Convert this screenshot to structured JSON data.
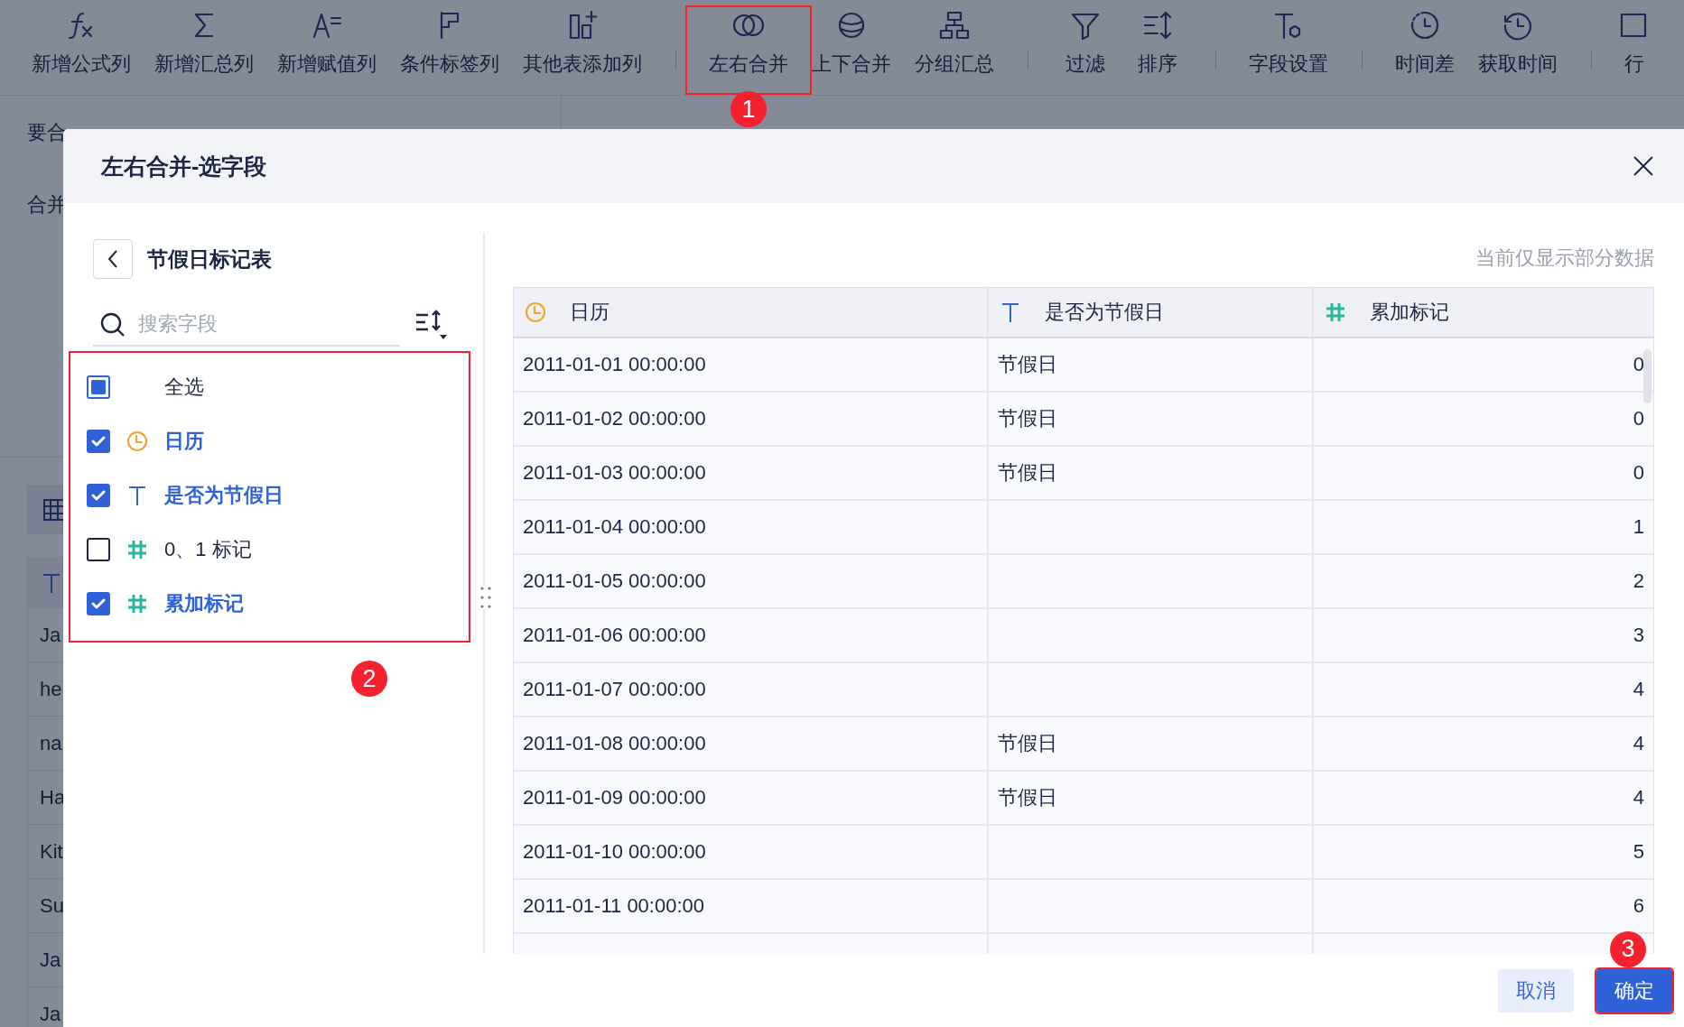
{
  "toolbar": {
    "items": [
      {
        "kind": "formula",
        "label": "新增公式列",
        "separator_before": false,
        "highlighted": false
      },
      {
        "kind": "sum",
        "label": "新增汇总列",
        "separator_before": false,
        "highlighted": false
      },
      {
        "kind": "assign",
        "label": "新增赋值列",
        "separator_before": false,
        "highlighted": false
      },
      {
        "kind": "tag",
        "label": "条件标签列",
        "separator_before": false,
        "highlighted": false
      },
      {
        "kind": "add-column",
        "label": "其他表添加列",
        "separator_before": false,
        "highlighted": false
      },
      {
        "kind": "join-lr",
        "label": "左右合并",
        "separator_before": true,
        "highlighted": true,
        "callout": "1"
      },
      {
        "kind": "join-tb",
        "label": "上下合并",
        "separator_before": false,
        "highlighted": false
      },
      {
        "kind": "group",
        "label": "分组汇总",
        "separator_before": false,
        "highlighted": false
      },
      {
        "kind": "filter",
        "label": "过滤",
        "separator_before": true,
        "highlighted": false
      },
      {
        "kind": "sort",
        "label": "排序",
        "separator_before": false,
        "highlighted": false
      },
      {
        "kind": "field-settings",
        "label": "字段设置",
        "separator_before": true,
        "highlighted": false
      },
      {
        "kind": "time-diff",
        "label": "时间差",
        "separator_before": true,
        "highlighted": false
      },
      {
        "kind": "get-time",
        "label": "获取时间",
        "separator_before": false,
        "highlighted": false
      },
      {
        "kind": "row",
        "label": "行",
        "separator_before": true,
        "highlighted": false
      }
    ]
  },
  "background": {
    "labels": [
      "要合",
      "合并"
    ],
    "table_rows": [
      "Ja",
      "he",
      "na",
      "Ha",
      "Kit",
      "Su",
      "Ja",
      "Ja"
    ]
  },
  "dialog": {
    "title": "左右合并-选字段",
    "source_table": "节假日标记表",
    "search": {
      "placeholder": "搜索字段"
    },
    "fields_callout": "2",
    "fields": [
      {
        "kind": "select-all",
        "label": "全选",
        "checked": false,
        "indeterminate": true
      },
      {
        "kind": "time",
        "label": "日历",
        "checked": true
      },
      {
        "kind": "text",
        "label": "是否为节假日",
        "checked": true
      },
      {
        "kind": "number",
        "label": "0、1 标记",
        "checked": false
      },
      {
        "kind": "number",
        "label": "累加标记",
        "checked": true
      }
    ],
    "preview_hint": "当前仅显示部分数据",
    "table": {
      "columns": [
        {
          "kind": "time",
          "label": "日历"
        },
        {
          "kind": "text",
          "label": "是否为节假日"
        },
        {
          "kind": "number",
          "label": "累加标记"
        }
      ],
      "rows": [
        [
          "2011-01-01 00:00:00",
          "节假日",
          "0"
        ],
        [
          "2011-01-02 00:00:00",
          "节假日",
          "0"
        ],
        [
          "2011-01-03 00:00:00",
          "节假日",
          "0"
        ],
        [
          "2011-01-04 00:00:00",
          null,
          "1"
        ],
        [
          "2011-01-05 00:00:00",
          null,
          "2"
        ],
        [
          "2011-01-06 00:00:00",
          null,
          "3"
        ],
        [
          "2011-01-07 00:00:00",
          null,
          "4"
        ],
        [
          "2011-01-08 00:00:00",
          "节假日",
          "4"
        ],
        [
          "2011-01-09 00:00:00",
          "节假日",
          "4"
        ],
        [
          "2011-01-10 00:00:00",
          null,
          "5"
        ],
        [
          "2011-01-11 00:00:00",
          null,
          "6"
        ]
      ]
    },
    "buttons": [
      {
        "kind": "secondary",
        "label": "取消"
      },
      {
        "kind": "primary",
        "label": "确定",
        "callout": "3"
      }
    ]
  }
}
